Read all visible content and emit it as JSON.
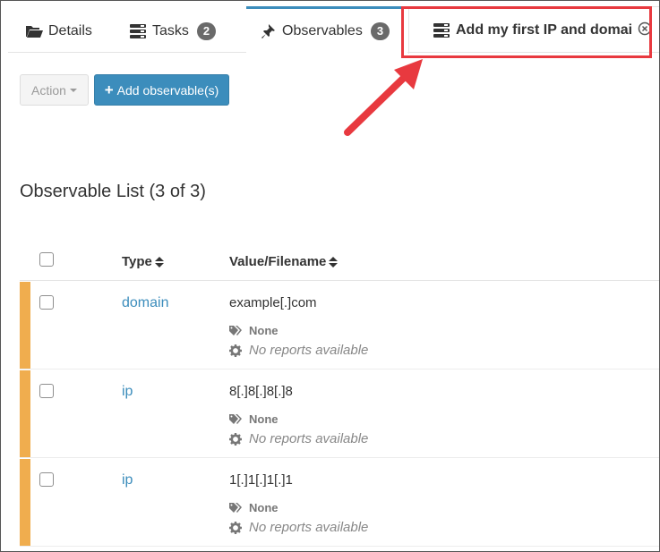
{
  "tabs": [
    {
      "label": "Details",
      "icon": "folder-open-icon"
    },
    {
      "label": "Tasks",
      "icon": "tasks-icon",
      "badge": "2"
    },
    {
      "label": "Observables",
      "icon": "thumbtack-icon",
      "badge": "3"
    },
    {
      "label": "Add my first IP and domai",
      "icon": "server-icon",
      "close_icon": "close-circle-icon"
    }
  ],
  "toolbar": {
    "action_label": "Action",
    "add_label": "Add observable(s)"
  },
  "list_title": "Observable List (3 of 3)",
  "table": {
    "headers": {
      "type": "Type",
      "value": "Value/Filename"
    },
    "rows": [
      {
        "type": "domain",
        "value": "example[.]com",
        "tags": "None",
        "reports": "No reports available"
      },
      {
        "type": "ip",
        "value": "8[.]8[.]8[.]8",
        "tags": "None",
        "reports": "No reports available"
      },
      {
        "type": "ip",
        "value": "1[.]1[.]1[.]1",
        "tags": "None",
        "reports": "No reports available"
      }
    ]
  },
  "colors": {
    "accent": "#3c8dbc",
    "row_marker": "#f0ad4e",
    "highlight": "#e8393f"
  }
}
